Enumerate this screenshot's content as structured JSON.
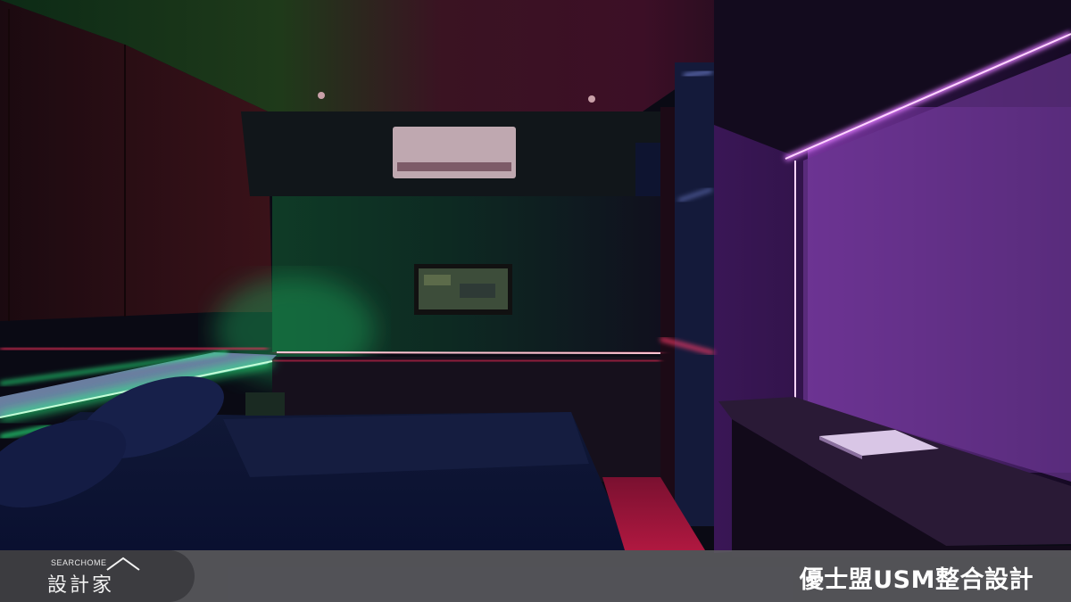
{
  "photo": {
    "subject": "bedroom",
    "lighting_colors": {
      "green": "#1fd36b",
      "red": "#ff2a5a",
      "purple": "#d04cff",
      "blue": "#5a7dff"
    }
  },
  "footer": {
    "brand_small": "SEARCHOME",
    "brand_large": "設計家",
    "credit": "優士盟USM整合設計"
  }
}
